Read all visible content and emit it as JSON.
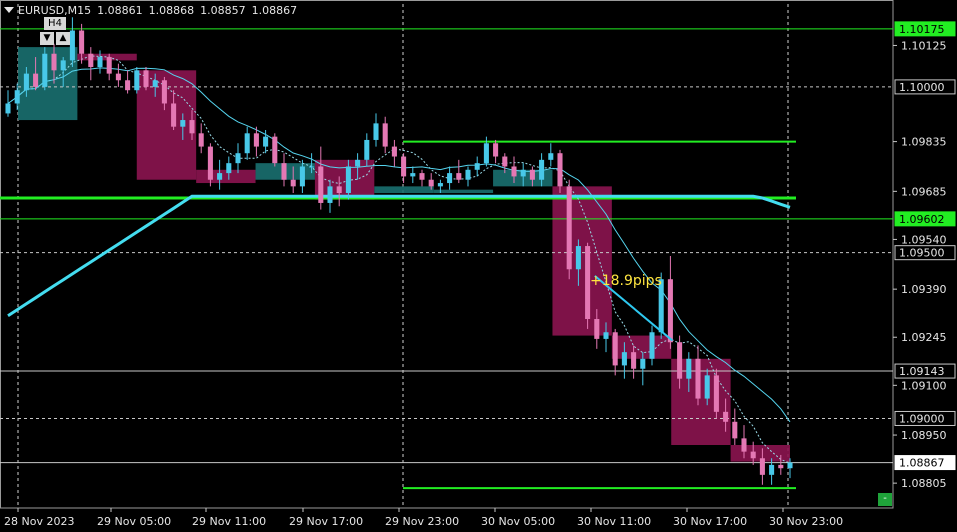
{
  "header": {
    "symbol": "EURUSD",
    "timeframe": "M15",
    "open": "1.08861",
    "high": "1.08868",
    "low": "1.08857",
    "close": "1.08867"
  },
  "timeframe_box": {
    "label": "H4",
    "down_button": "▼",
    "up_button": "▲"
  },
  "mini_button": "-",
  "annotation": "+18.9pips",
  "colors": {
    "bull": "#48c8e8",
    "bear": "#e478b4",
    "box_bull": "#1a7070",
    "box_bear": "#8c1450",
    "level": "#22ee22",
    "ma_fast": "#55d4ee",
    "ma_slow": "#44ddf0",
    "grid": "#c8c8c8"
  },
  "chart_data": {
    "type": "candlestick",
    "symbol": "EURUSD",
    "timeframe": "M15",
    "ylim": [
      1.0873,
      1.1025
    ],
    "y_ticks": [
      "1.10125",
      "1.09835",
      "1.09685",
      "1.09540",
      "1.09390",
      "1.09245",
      "1.09100",
      "1.08950",
      "1.08805"
    ],
    "x_ticks": [
      "28 Nov 2023",
      "29 Nov 05:00",
      "29 Nov 11:00",
      "29 Nov 17:00",
      "29 Nov 23:00",
      "30 Nov 05:00",
      "30 Nov 11:00",
      "30 Nov 17:00",
      "30 Nov 23:00"
    ],
    "price_labels": [
      {
        "value": "1.10175",
        "style": "green"
      },
      {
        "value": "1.10000",
        "style": "dark"
      },
      {
        "value": "1.09602",
        "style": "green"
      },
      {
        "value": "1.09500",
        "style": "dark"
      },
      {
        "value": "1.09143",
        "style": "dark"
      },
      {
        "value": "1.09000",
        "style": "dark"
      },
      {
        "value": "1.08867",
        "style": "current"
      }
    ],
    "horizontal_lines": [
      {
        "price": 1.10175,
        "style": "green-thin",
        "span": "full"
      },
      {
        "price": 1.1,
        "style": "white-dashed",
        "span": "full"
      },
      {
        "price": 1.09835,
        "style": "green",
        "span": "partial"
      },
      {
        "price": 1.09665,
        "style": "green-thick",
        "span": "partial"
      },
      {
        "price": 1.09602,
        "style": "green-thin",
        "span": "full"
      },
      {
        "price": 1.095,
        "style": "white-dashed",
        "span": "full"
      },
      {
        "price": 1.09143,
        "style": "white-thin",
        "span": "full"
      },
      {
        "price": 1.09,
        "style": "white-dashed",
        "span": "full"
      },
      {
        "price": 1.08867,
        "style": "white-thin",
        "span": "full"
      },
      {
        "price": 1.0879,
        "style": "green",
        "span": "partial"
      }
    ],
    "h4_boxes": [
      {
        "open": 1.099,
        "close": 1.1012,
        "dir": "bull"
      },
      {
        "open": 1.101,
        "close": 1.1008,
        "dir": "bear"
      },
      {
        "open": 1.1005,
        "close": 1.0972,
        "dir": "bear"
      },
      {
        "open": 1.0975,
        "close": 1.0971,
        "dir": "bear"
      },
      {
        "open": 1.0972,
        "close": 1.0977,
        "dir": "bull"
      },
      {
        "open": 1.0978,
        "close": 1.0966,
        "dir": "bear"
      },
      {
        "open": 1.0968,
        "close": 1.097,
        "dir": "bull"
      },
      {
        "open": 1.0968,
        "close": 1.0969,
        "dir": "bull"
      },
      {
        "open": 1.0975,
        "close": 1.097,
        "dir": "bull"
      },
      {
        "open": 1.097,
        "close": 1.0925,
        "dir": "bear"
      },
      {
        "open": 1.0925,
        "close": 1.0918,
        "dir": "bear"
      },
      {
        "open": 1.0918,
        "close": 1.0892,
        "dir": "bear"
      },
      {
        "open": 1.0892,
        "close": 1.0887,
        "dir": "bear"
      }
    ],
    "candles": [
      {
        "o": 1.0992,
        "h": 1.0999,
        "l": 1.0991,
        "c": 1.0995
      },
      {
        "o": 1.0995,
        "h": 1.1001,
        "l": 1.0993,
        "c": 1.0999
      },
      {
        "o": 1.0999,
        "h": 1.1006,
        "l": 1.0997,
        "c": 1.1004
      },
      {
        "o": 1.1004,
        "h": 1.1009,
        "l": 1.0999,
        "c": 1.1
      },
      {
        "o": 1.1,
        "h": 1.1012,
        "l": 1.0999,
        "c": 1.101
      },
      {
        "o": 1.101,
        "h": 1.1013,
        "l": 1.1001,
        "c": 1.1005
      },
      {
        "o": 1.1005,
        "h": 1.1009,
        "l": 1.1,
        "c": 1.1008
      },
      {
        "o": 1.1008,
        "h": 1.1021,
        "l": 1.1006,
        "c": 1.1017
      },
      {
        "o": 1.1017,
        "h": 1.1019,
        "l": 1.1007,
        "c": 1.101
      },
      {
        "o": 1.101,
        "h": 1.1012,
        "l": 1.1002,
        "c": 1.1006
      },
      {
        "o": 1.1006,
        "h": 1.1011,
        "l": 1.1004,
        "c": 1.1009
      },
      {
        "o": 1.1009,
        "h": 1.101,
        "l": 1.1002,
        "c": 1.1004
      },
      {
        "o": 1.1004,
        "h": 1.1007,
        "l": 1.1,
        "c": 1.1002
      },
      {
        "o": 1.1002,
        "h": 1.1005,
        "l": 1.0998,
        "c": 1.0999
      },
      {
        "o": 1.0999,
        "h": 1.1006,
        "l": 1.0998,
        "c": 1.1005
      },
      {
        "o": 1.1005,
        "h": 1.1006,
        "l": 1.0999,
        "c": 1.1
      },
      {
        "o": 1.1,
        "h": 1.1004,
        "l": 1.0997,
        "c": 1.1002
      },
      {
        "o": 1.1002,
        "h": 1.1003,
        "l": 1.0993,
        "c": 1.0995
      },
      {
        "o": 1.0995,
        "h": 1.0999,
        "l": 1.0987,
        "c": 1.0988
      },
      {
        "o": 1.0988,
        "h": 1.0992,
        "l": 1.0984,
        "c": 1.099
      },
      {
        "o": 1.099,
        "h": 1.0993,
        "l": 1.0984,
        "c": 1.0986
      },
      {
        "o": 1.0986,
        "h": 1.0989,
        "l": 1.098,
        "c": 1.0982
      },
      {
        "o": 1.0982,
        "h": 1.0983,
        "l": 1.097,
        "c": 1.0972
      },
      {
        "o": 1.0972,
        "h": 1.0978,
        "l": 1.0969,
        "c": 1.0974
      },
      {
        "o": 1.0974,
        "h": 1.0979,
        "l": 1.0972,
        "c": 1.0977
      },
      {
        "o": 1.0977,
        "h": 1.0983,
        "l": 1.0974,
        "c": 1.098
      },
      {
        "o": 1.098,
        "h": 1.0988,
        "l": 1.0978,
        "c": 1.0986
      },
      {
        "o": 1.0986,
        "h": 1.0988,
        "l": 1.0979,
        "c": 1.0982
      },
      {
        "o": 1.0982,
        "h": 1.0987,
        "l": 1.098,
        "c": 1.0985
      },
      {
        "o": 1.0985,
        "h": 1.0986,
        "l": 1.0976,
        "c": 1.0977
      },
      {
        "o": 1.0977,
        "h": 1.098,
        "l": 1.097,
        "c": 1.0972
      },
      {
        "o": 1.0972,
        "h": 1.0976,
        "l": 1.0968,
        "c": 1.097
      },
      {
        "o": 1.097,
        "h": 1.0978,
        "l": 1.0968,
        "c": 1.0976
      },
      {
        "o": 1.0976,
        "h": 1.098,
        "l": 1.0974,
        "c": 1.0976
      },
      {
        "o": 1.0976,
        "h": 1.0982,
        "l": 1.0963,
        "c": 1.0965
      },
      {
        "o": 1.0965,
        "h": 1.0972,
        "l": 1.0962,
        "c": 1.097
      },
      {
        "o": 1.097,
        "h": 1.0973,
        "l": 1.0964,
        "c": 1.0968
      },
      {
        "o": 1.0968,
        "h": 1.0978,
        "l": 1.0966,
        "c": 1.0976
      },
      {
        "o": 1.0976,
        "h": 1.098,
        "l": 1.0972,
        "c": 1.0978
      },
      {
        "o": 1.0978,
        "h": 1.0986,
        "l": 1.0976,
        "c": 1.0984
      },
      {
        "o": 1.0984,
        "h": 1.0992,
        "l": 1.0982,
        "c": 1.0989
      },
      {
        "o": 1.0989,
        "h": 1.0991,
        "l": 1.098,
        "c": 1.0982
      },
      {
        "o": 1.0982,
        "h": 1.0984,
        "l": 1.0976,
        "c": 1.0979
      },
      {
        "o": 1.0979,
        "h": 1.098,
        "l": 1.0971,
        "c": 1.0973
      },
      {
        "o": 1.0973,
        "h": 1.0976,
        "l": 1.0971,
        "c": 1.0974
      },
      {
        "o": 1.0974,
        "h": 1.0975,
        "l": 1.097,
        "c": 1.0972
      },
      {
        "o": 1.0972,
        "h": 1.0974,
        "l": 1.0969,
        "c": 1.097
      },
      {
        "o": 1.097,
        "h": 1.0972,
        "l": 1.0968,
        "c": 1.0971
      },
      {
        "o": 1.0971,
        "h": 1.0976,
        "l": 1.0969,
        "c": 1.0974
      },
      {
        "o": 1.0974,
        "h": 1.0978,
        "l": 1.0971,
        "c": 1.0972
      },
      {
        "o": 1.0972,
        "h": 1.0976,
        "l": 1.097,
        "c": 1.0975
      },
      {
        "o": 1.0975,
        "h": 1.0979,
        "l": 1.0973,
        "c": 1.0977
      },
      {
        "o": 1.0977,
        "h": 1.0985,
        "l": 1.0976,
        "c": 1.0983
      },
      {
        "o": 1.0983,
        "h": 1.0984,
        "l": 1.0977,
        "c": 1.0979
      },
      {
        "o": 1.0979,
        "h": 1.098,
        "l": 1.0974,
        "c": 1.0976
      },
      {
        "o": 1.0976,
        "h": 1.0979,
        "l": 1.0971,
        "c": 1.0973
      },
      {
        "o": 1.0973,
        "h": 1.0977,
        "l": 1.097,
        "c": 1.0975
      },
      {
        "o": 1.0975,
        "h": 1.0976,
        "l": 1.097,
        "c": 1.0972
      },
      {
        "o": 1.0972,
        "h": 1.098,
        "l": 1.097,
        "c": 1.0978
      },
      {
        "o": 1.0978,
        "h": 1.0983,
        "l": 1.0976,
        "c": 1.098
      },
      {
        "o": 1.098,
        "h": 1.0981,
        "l": 1.0968,
        "c": 1.097
      },
      {
        "o": 1.097,
        "h": 1.0972,
        "l": 1.0942,
        "c": 1.0945
      },
      {
        "o": 1.0945,
        "h": 1.0954,
        "l": 1.094,
        "c": 1.0952
      },
      {
        "o": 1.0952,
        "h": 1.0953,
        "l": 1.0927,
        "c": 1.093
      },
      {
        "o": 1.093,
        "h": 1.0933,
        "l": 1.0921,
        "c": 1.0924
      },
      {
        "o": 1.0924,
        "h": 1.0929,
        "l": 1.092,
        "c": 1.0926
      },
      {
        "o": 1.0926,
        "h": 1.0927,
        "l": 1.0913,
        "c": 1.0916
      },
      {
        "o": 1.0916,
        "h": 1.0923,
        "l": 1.0912,
        "c": 1.092
      },
      {
        "o": 1.092,
        "h": 1.0922,
        "l": 1.0912,
        "c": 1.0915
      },
      {
        "o": 1.0915,
        "h": 1.092,
        "l": 1.091,
        "c": 1.0918
      },
      {
        "o": 1.0918,
        "h": 1.0928,
        "l": 1.0916,
        "c": 1.0926
      },
      {
        "o": 1.0926,
        "h": 1.0944,
        "l": 1.0924,
        "c": 1.0942
      },
      {
        "o": 1.0942,
        "h": 1.0949,
        "l": 1.0921,
        "c": 1.0923
      },
      {
        "o": 1.0923,
        "h": 1.0925,
        "l": 1.0909,
        "c": 1.0912
      },
      {
        "o": 1.0912,
        "h": 1.092,
        "l": 1.0908,
        "c": 1.0918
      },
      {
        "o": 1.0918,
        "h": 1.0922,
        "l": 1.0904,
        "c": 1.0906
      },
      {
        "o": 1.0906,
        "h": 1.0915,
        "l": 1.0904,
        "c": 1.0913
      },
      {
        "o": 1.0913,
        "h": 1.0915,
        "l": 1.09,
        "c": 1.0902
      },
      {
        "o": 1.0902,
        "h": 1.0906,
        "l": 1.0896,
        "c": 1.0899
      },
      {
        "o": 1.0899,
        "h": 1.0903,
        "l": 1.0892,
        "c": 1.0894
      },
      {
        "o": 1.0894,
        "h": 1.0898,
        "l": 1.0888,
        "c": 1.089
      },
      {
        "o": 1.089,
        "h": 1.0893,
        "l": 1.0886,
        "c": 1.0888
      },
      {
        "o": 1.0888,
        "h": 1.0891,
        "l": 1.088,
        "c": 1.0883
      },
      {
        "o": 1.0883,
        "h": 1.0888,
        "l": 1.088,
        "c": 1.0886
      },
      {
        "o": 1.0886,
        "h": 1.0889,
        "l": 1.0883,
        "c": 1.0885
      },
      {
        "o": 1.0885,
        "h": 1.0888,
        "l": 1.0882,
        "c": 1.08867
      }
    ]
  }
}
